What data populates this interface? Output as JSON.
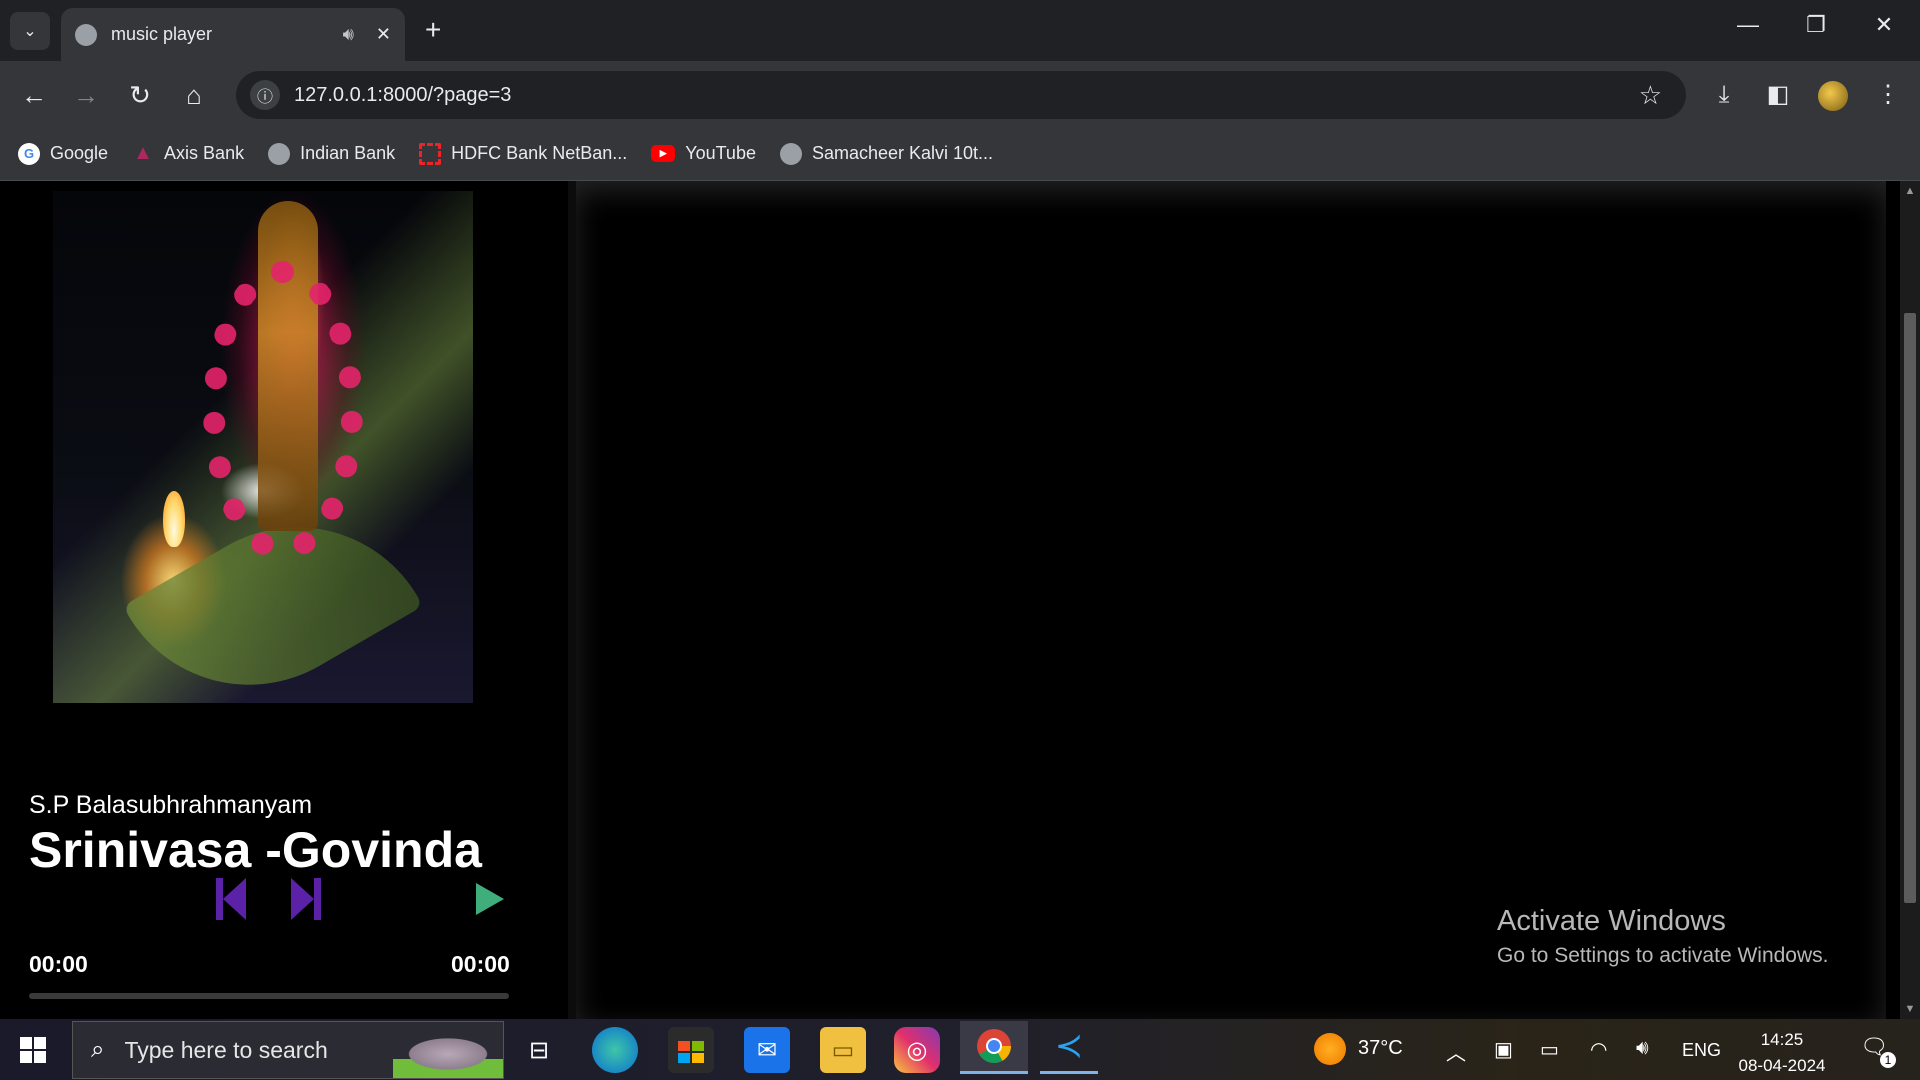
{
  "browser": {
    "tab_title": "music player",
    "url": "127.0.0.1:8000/?page=3",
    "bookmarks": [
      {
        "label": "Google",
        "icon": "google-icon",
        "color": "#4285f4"
      },
      {
        "label": "Axis Bank",
        "icon": "axis-bank-icon",
        "color": "#ae275f"
      },
      {
        "label": "Indian Bank",
        "icon": "globe-icon",
        "color": "#9aa0a6"
      },
      {
        "label": "HDFC Bank NetBan...",
        "icon": "hdfc-icon",
        "color": "#ed232a"
      },
      {
        "label": "YouTube",
        "icon": "youtube-icon",
        "color": "#ff0000"
      },
      {
        "label": "Samacheer Kalvi 10t...",
        "icon": "globe-icon",
        "color": "#9aa0a6"
      }
    ]
  },
  "player": {
    "artist": "S.P Balasubhrahmanyam",
    "song": "Srinivasa -Govinda",
    "current_time": "00:00",
    "duration": "00:00",
    "progress": 0,
    "control_color": "#5b21a6",
    "play_color": "#3fae7a"
  },
  "watermark": {
    "heading": "Activate Windows",
    "subtext": "Go to Settings to activate Windows."
  },
  "taskbar": {
    "search_placeholder": "Type here to search",
    "weather": "37°C",
    "language": "ENG",
    "time": "14:25",
    "date": "08-04-2024",
    "notification_count": "1"
  }
}
